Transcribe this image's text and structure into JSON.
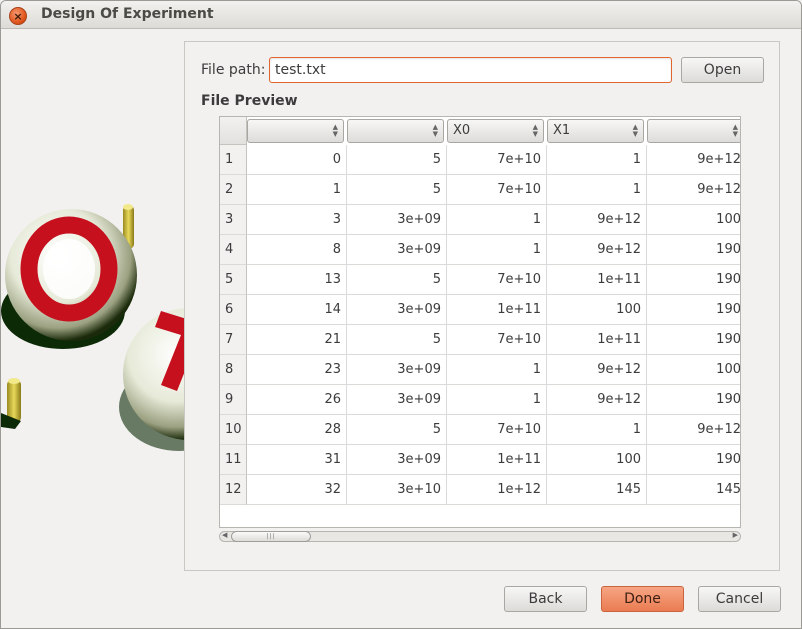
{
  "window": {
    "title": "Design Of Experiment"
  },
  "icons": {
    "close": "close-icon",
    "sort_spinner": "sort-spinner-icon",
    "scroll_grip": "grip-icon"
  },
  "file": {
    "label": "File path:",
    "value": "test.txt",
    "open_label": "Open"
  },
  "preview": {
    "label": "File Preview",
    "headers": [
      "",
      "",
      "X0",
      "X1",
      ""
    ],
    "rows": [
      {
        "num": "1",
        "cells": [
          "0",
          "5",
          "7e+10",
          "1",
          "9e+12"
        ]
      },
      {
        "num": "2",
        "cells": [
          "1",
          "5",
          "7e+10",
          "1",
          "9e+12"
        ]
      },
      {
        "num": "3",
        "cells": [
          "3",
          "3e+09",
          "1",
          "9e+12",
          "100"
        ]
      },
      {
        "num": "4",
        "cells": [
          "8",
          "3e+09",
          "1",
          "9e+12",
          "190"
        ]
      },
      {
        "num": "5",
        "cells": [
          "13",
          "5",
          "7e+10",
          "1e+11",
          "190"
        ]
      },
      {
        "num": "6",
        "cells": [
          "14",
          "3e+09",
          "1e+11",
          "100",
          "190"
        ]
      },
      {
        "num": "7",
        "cells": [
          "21",
          "5",
          "7e+10",
          "1e+11",
          "190"
        ]
      },
      {
        "num": "8",
        "cells": [
          "23",
          "3e+09",
          "1",
          "9e+12",
          "100"
        ]
      },
      {
        "num": "9",
        "cells": [
          "26",
          "3e+09",
          "1",
          "9e+12",
          "190"
        ]
      },
      {
        "num": "10",
        "cells": [
          "28",
          "5",
          "7e+10",
          "1",
          "9e+12"
        ]
      },
      {
        "num": "11",
        "cells": [
          "31",
          "3e+09",
          "1e+11",
          "100",
          "190"
        ]
      },
      {
        "num": "12",
        "cells": [
          "32",
          "3e+10",
          "1e+12",
          "145",
          "145"
        ]
      }
    ]
  },
  "footer": {
    "back_label": "Back",
    "done_label": "Done",
    "cancel_label": "Cancel"
  },
  "colors": {
    "accent": "#e0652e",
    "done_button": "#ea7c52",
    "window_bg": "#f2f1f0"
  }
}
